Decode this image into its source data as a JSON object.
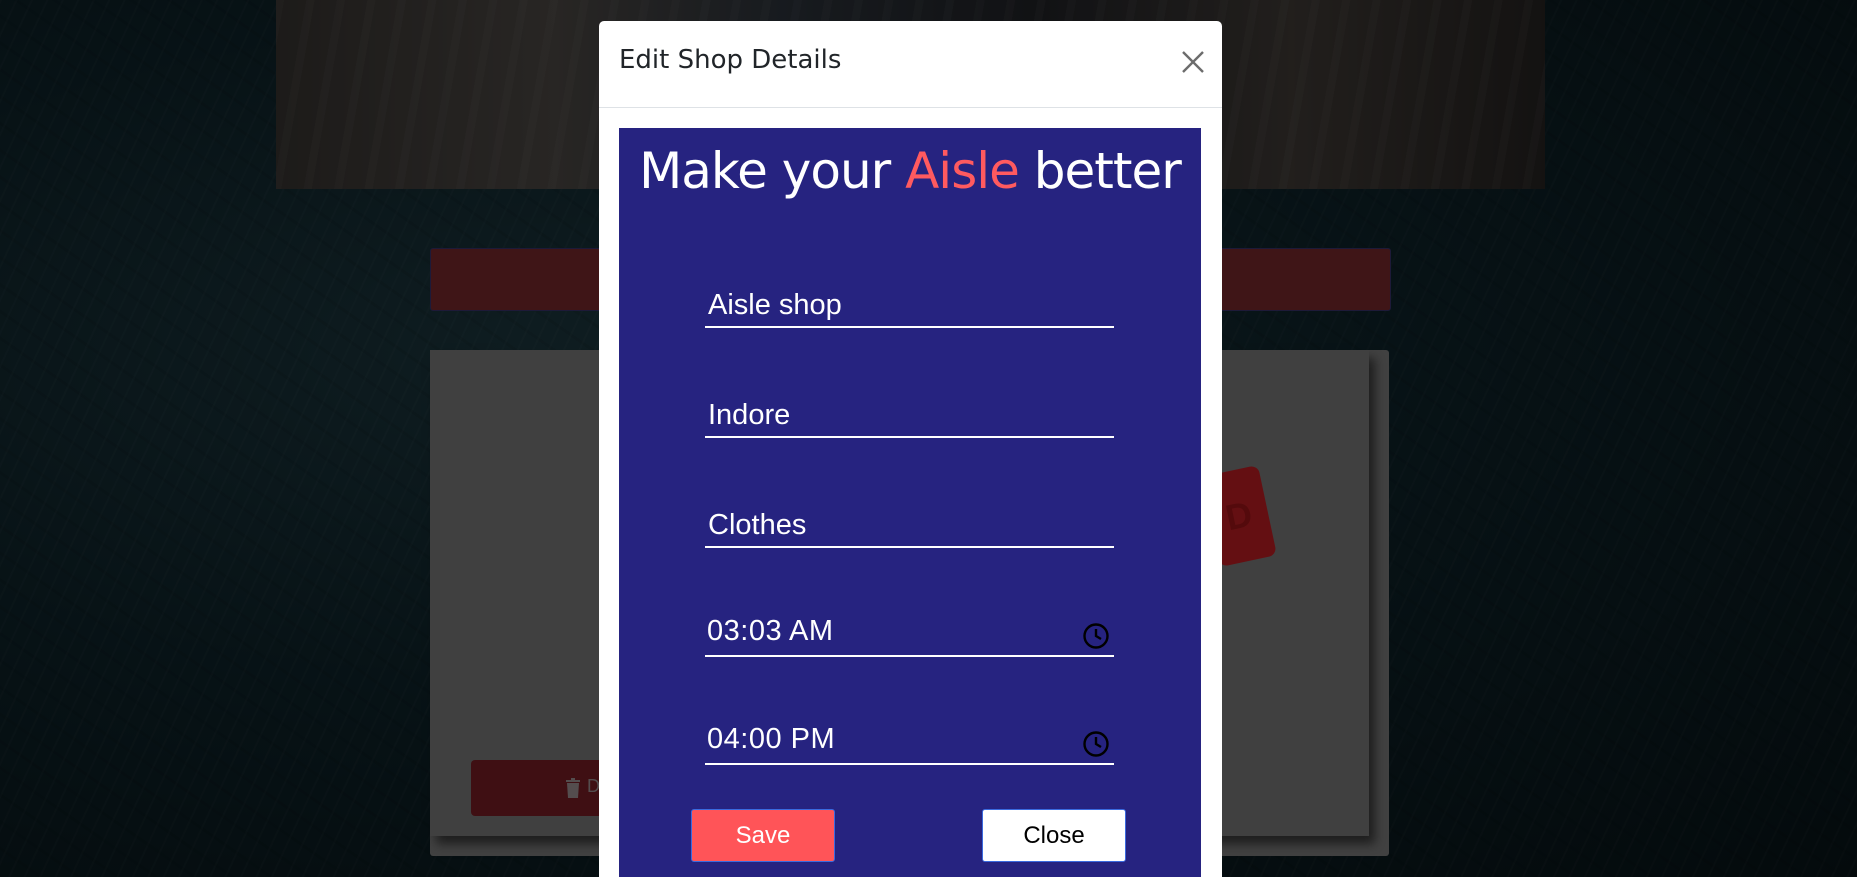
{
  "modal": {
    "title": "Edit Shop Details",
    "headline_prefix": "Make your ",
    "headline_accent": "Aisle",
    "headline_suffix": " better",
    "fields": {
      "shop_name": "Aisle shop",
      "city": "Indore",
      "category": "Clothes",
      "opening_time": "03:03 AM",
      "closing_time": "04:00 PM"
    },
    "save_label": "Save",
    "close_label": "Close"
  },
  "background_card": {
    "delete_label": "D",
    "sold_stamp_text": "D"
  },
  "colors": {
    "panel": "#262380",
    "accent": "#ff5a5f",
    "save_button": "#ff5458"
  },
  "icons": {
    "close": "close-icon",
    "clock": "clock-icon",
    "trash": "trash-icon"
  }
}
